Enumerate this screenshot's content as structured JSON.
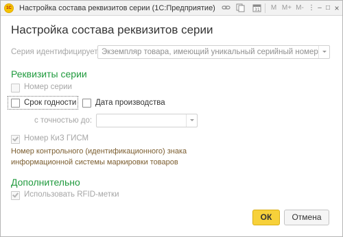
{
  "window": {
    "app_logo_text": "1С",
    "title": "Настройка состава реквизитов серии  (1С:Предприятие)",
    "toolbar": {
      "m_label": "M",
      "m_plus_label": "M+",
      "m_minus_label": "M-",
      "more_label": "⋮",
      "minimize_label": "–",
      "maximize_label": "□",
      "close_label": "×"
    }
  },
  "dialog": {
    "title": "Настройка состава реквизитов серии",
    "series_identifies_label": "Серия идентифицирует:",
    "series_identifies_value": "Экземпляр товара, имеющий уникальный серийный номер",
    "section_series_attrs": "Реквизиты серии",
    "series_number_label": "Номер серии",
    "series_number_checked": false,
    "expiry_label": "Срок годности",
    "expiry_checked": false,
    "production_date_label": "Дата производства",
    "production_date_checked": false,
    "accuracy_label": "с точностью до:",
    "accuracy_value": "",
    "kiz_label": "Номер КиЗ ГИСМ",
    "kiz_checked": true,
    "kiz_hint_line1": "Номер контрольного (идентификационного) знака",
    "kiz_hint_line2": "информационной системы маркировки товаров",
    "section_additional": "Дополнительно",
    "rfid_label": "Использовать RFID-метки",
    "rfid_checked": true
  },
  "buttons": {
    "ok": "ОК",
    "cancel": "Отмена"
  },
  "colors": {
    "section_green": "#1f9a3d",
    "ok_button_yellow": "#f7d13a",
    "hint_brown": "#7a5c2e",
    "disabled_gray": "#a6a6a6"
  }
}
